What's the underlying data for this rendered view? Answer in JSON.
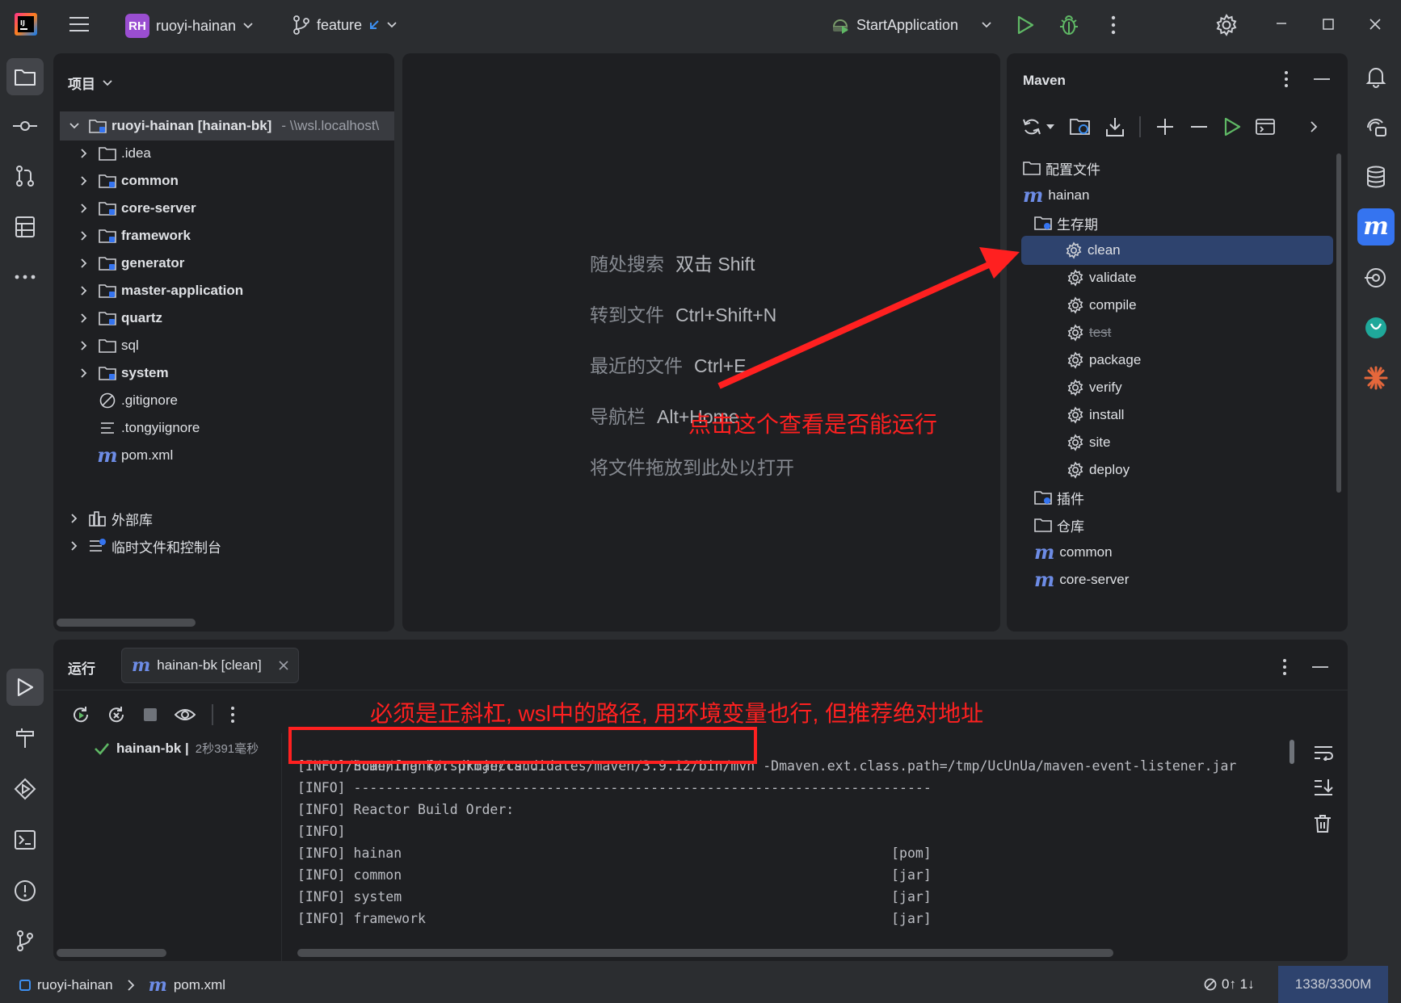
{
  "colors": {
    "accent": "#3574f0",
    "annotation": "#ff2020",
    "success": "#5fb865",
    "run_green": "#5fb865"
  },
  "titlebar": {
    "project_badge": "RH",
    "project_name": "ruoyi-hainan",
    "branch": "feature",
    "run_config": "StartApplication"
  },
  "project_panel": {
    "title": "项目",
    "root_name": "ruoyi-hainan [hainan-bk]",
    "root_path": "- \\\\wsl.localhost\\",
    "items": [
      {
        "label": ".idea",
        "bold": false
      },
      {
        "label": "common",
        "bold": true
      },
      {
        "label": "core-server",
        "bold": true
      },
      {
        "label": "framework",
        "bold": true
      },
      {
        "label": "generator",
        "bold": true
      },
      {
        "label": "master-application",
        "bold": true
      },
      {
        "label": "quartz",
        "bold": true
      },
      {
        "label": "sql",
        "bold": false
      },
      {
        "label": "system",
        "bold": true
      },
      {
        "label": ".gitignore",
        "bold": false
      },
      {
        "label": ".tongyiignore",
        "bold": false
      },
      {
        "label": "pom.xml",
        "bold": false
      }
    ],
    "external_libs": "外部库",
    "scratches": "临时文件和控制台"
  },
  "welcome": {
    "hints": [
      {
        "label": "随处搜索",
        "key": "双击 Shift"
      },
      {
        "label": "转到文件",
        "key": "Ctrl+Shift+N"
      },
      {
        "label": "最近的文件",
        "key": "Ctrl+E"
      },
      {
        "label": "导航栏",
        "key": "Alt+Home"
      },
      {
        "label": "将文件拖放到此处以打开",
        "key": ""
      }
    ]
  },
  "maven": {
    "title": "Maven",
    "profiles": "配置文件",
    "project": "hainan",
    "lifecycle": "生存期",
    "phases": [
      "clean",
      "validate",
      "compile",
      "test",
      "package",
      "verify",
      "install",
      "site",
      "deploy"
    ],
    "selected_phase": "clean",
    "plugins": "插件",
    "repositories": "仓库",
    "modules": [
      "common",
      "core-server"
    ]
  },
  "run": {
    "label": "运行",
    "tab_title": "hainan-bk [clean]",
    "tree_item": "hainan-bk |",
    "tree_time": "2秒391毫秒",
    "command_path": "/home/frank/.sdkman/candidates/maven/3.9.12/bin/mvn",
    "command_rest": "-Dmaven.ext.class.path=/tmp/UcUnUa/maven-event-listener.jar",
    "lines": [
      "[INFO] Scanning for projects...",
      "[INFO] ------------------------------------------------------------------------",
      "[INFO] Reactor Build Order:",
      "[INFO]",
      "[INFO] hainan                                                             [pom]",
      "[INFO] common                                                             [jar]",
      "[INFO] system                                                             [jar]",
      "[INFO] framework                                                          [jar]"
    ]
  },
  "annotations": {
    "maven_hint": "点击这个查看是否能运行",
    "path_hint": "必须是正斜杠, wsl中的路径, 用环境变量也行, 但推荐绝对地址"
  },
  "statusbar": {
    "project": "ruoyi-hainan",
    "file": "pom.xml",
    "vcs": "0↑ 1↓",
    "memory": "1338/3300M"
  }
}
